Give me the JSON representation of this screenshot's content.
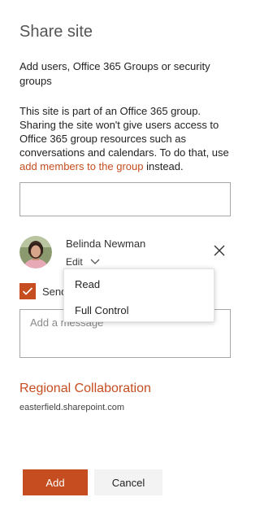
{
  "panel": {
    "title": "Share site",
    "subtitle": "Add users, Office 365 Groups or security groups",
    "info_text_before": "This site is part of an Office 365 group. Sharing the site won't give users access to Office 365 group resources such as conversations and calendars. To do that, use ",
    "info_link": "add members to the group",
    "info_text_after": " instead."
  },
  "people_picker": {
    "value": ""
  },
  "user": {
    "name": "Belinda Newman",
    "permission": "Edit"
  },
  "permission_menu": {
    "items": [
      {
        "label": "Read"
      },
      {
        "label": "Full Control"
      }
    ]
  },
  "send_email": {
    "checked": true,
    "label": "Send"
  },
  "message": {
    "placeholder": "Add a message"
  },
  "site": {
    "name": "Regional Collaboration",
    "url": "easterfield.sharepoint.com"
  },
  "buttons": {
    "add": "Add",
    "cancel": "Cancel"
  },
  "colors": {
    "accent": "#c64d1f",
    "text": "#333333",
    "border": "#a6a6a6"
  }
}
